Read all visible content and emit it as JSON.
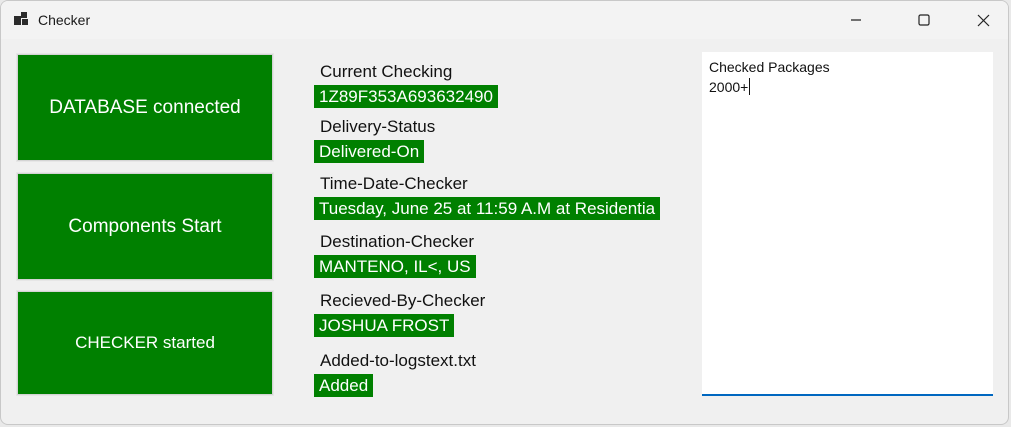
{
  "window": {
    "title": "Checker",
    "icon": "app-window-icon",
    "controls": [
      "minimize-icon",
      "maximize-icon",
      "close-icon"
    ]
  },
  "colors": {
    "accent_green": "#008000",
    "focus_blue": "#0067c0"
  },
  "buttons": {
    "database": "DATABASE connected",
    "components": "Components Start",
    "checker": "CHECKER started"
  },
  "fields": {
    "current_checking": {
      "label": "Current Checking",
      "value": "1Z89F353A693632490"
    },
    "delivery_status": {
      "label": "Delivery-Status",
      "value": "Delivered-On"
    },
    "time_date": {
      "label": "Time-Date-Checker",
      "value": "Tuesday, June 25 at 11:59 A.M at Residentia"
    },
    "destination": {
      "label": "Destination-Checker",
      "value": "MANTENO, IL<, US"
    },
    "received_by": {
      "label": "Recieved-By-Checker",
      "value": "JOSHUA FROST"
    },
    "added_to_log": {
      "label": "Added-to-logstext.txt",
      "value": "Added"
    }
  },
  "textbox": {
    "line1": "Checked Packages",
    "line2": "2000+"
  }
}
